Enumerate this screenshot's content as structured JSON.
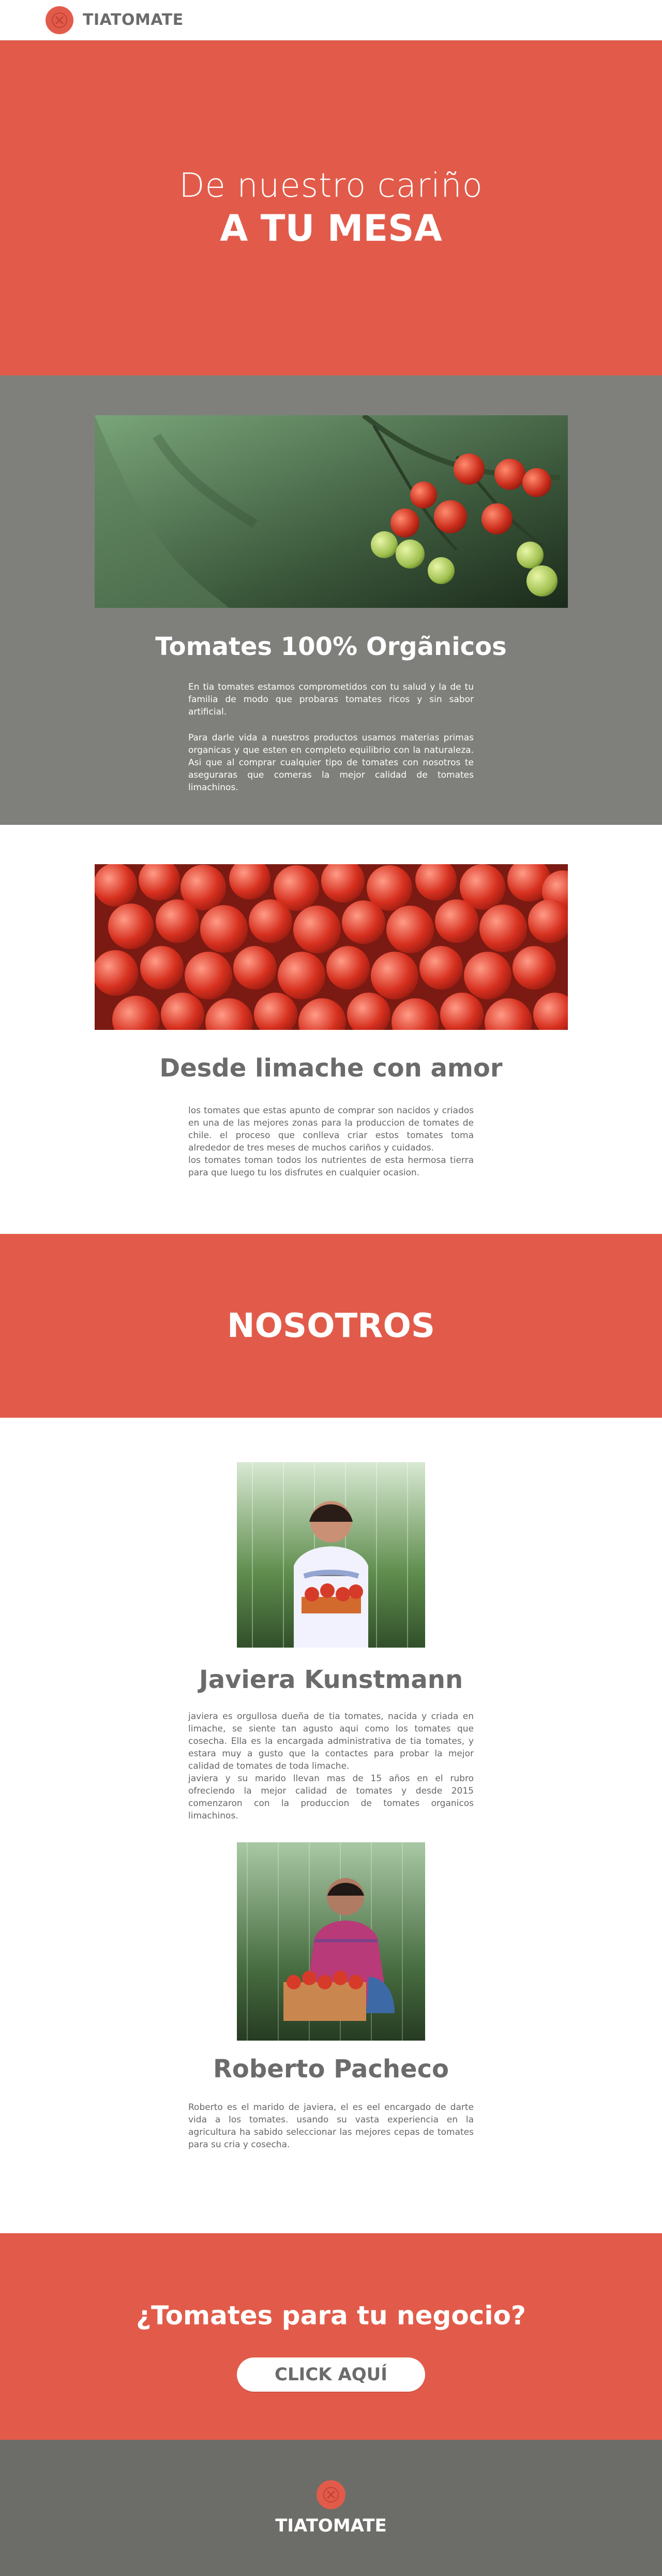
{
  "brand": {
    "name": "TIATOMATE",
    "accent": "#e25b4a",
    "gray": "#7f807b",
    "dark": "#6c6d68"
  },
  "hero": {
    "line1": "De nuestro cariño",
    "line2": "A TU MESA"
  },
  "organic": {
    "title": "Tomates 100% Orgãnicos",
    "paragraphs": [
      "En tia tomates estamos comprometidos con tu salud y la de tu familia de modo que probaras tomates ricos y sin sabor artificial.",
      "Para darle vida a nuestros productos usamos materias primas organicas y que esten en completo equilibrio con la naturaleza. Asi que al comprar cualquier tipo de tomates con nosotros te aseguraras que comeras la mejor calidad de tomates limachinos."
    ]
  },
  "limache": {
    "title": "Desde limache con amor",
    "text": "los tomates que estas apunto de comprar son nacidos y criados en una de las mejores zonas para la produccion de tomates de chile. el proceso que conlleva criar estos tomates toma alrededor de tres meses de muchos cariños y cuidados.\nlos tomates toman todos los nutrientes de esta hermosa tierra para que luego tu los disfrutes en cualquier ocasion."
  },
  "nosotros": {
    "title": "NOSOTROS"
  },
  "people": [
    {
      "name": "Javiera Kunstmann",
      "bio": "javiera es orgullosa dueña de tia tomates, nacida y criada en limache, se siente tan agusto aqui como los tomates que cosecha. Ella es la encargada administrativa de tia tomates, y estara muy a gusto que la contactes para probar la mejor calidad de tomates de toda limache.\njaviera y su marido llevan mas de 15 años en el rubro ofreciendo la mejor calidad de tomates y desde 2015 comenzaron con la produccion de tomates organicos limachinos."
    },
    {
      "name": "Roberto Pacheco",
      "bio": "Roberto es el marido de javiera, el es eel encargado de darte vida a los tomates. usando su vasta experiencia en la agricultura ha sabido seleccionar las mejores cepas de tomates para su cria y cosecha."
    }
  ],
  "business": {
    "title": "¿Tomates para tu negocio?",
    "cta": "CLICK AQUÍ"
  },
  "footer": {
    "brand": "TIATOMATE"
  }
}
